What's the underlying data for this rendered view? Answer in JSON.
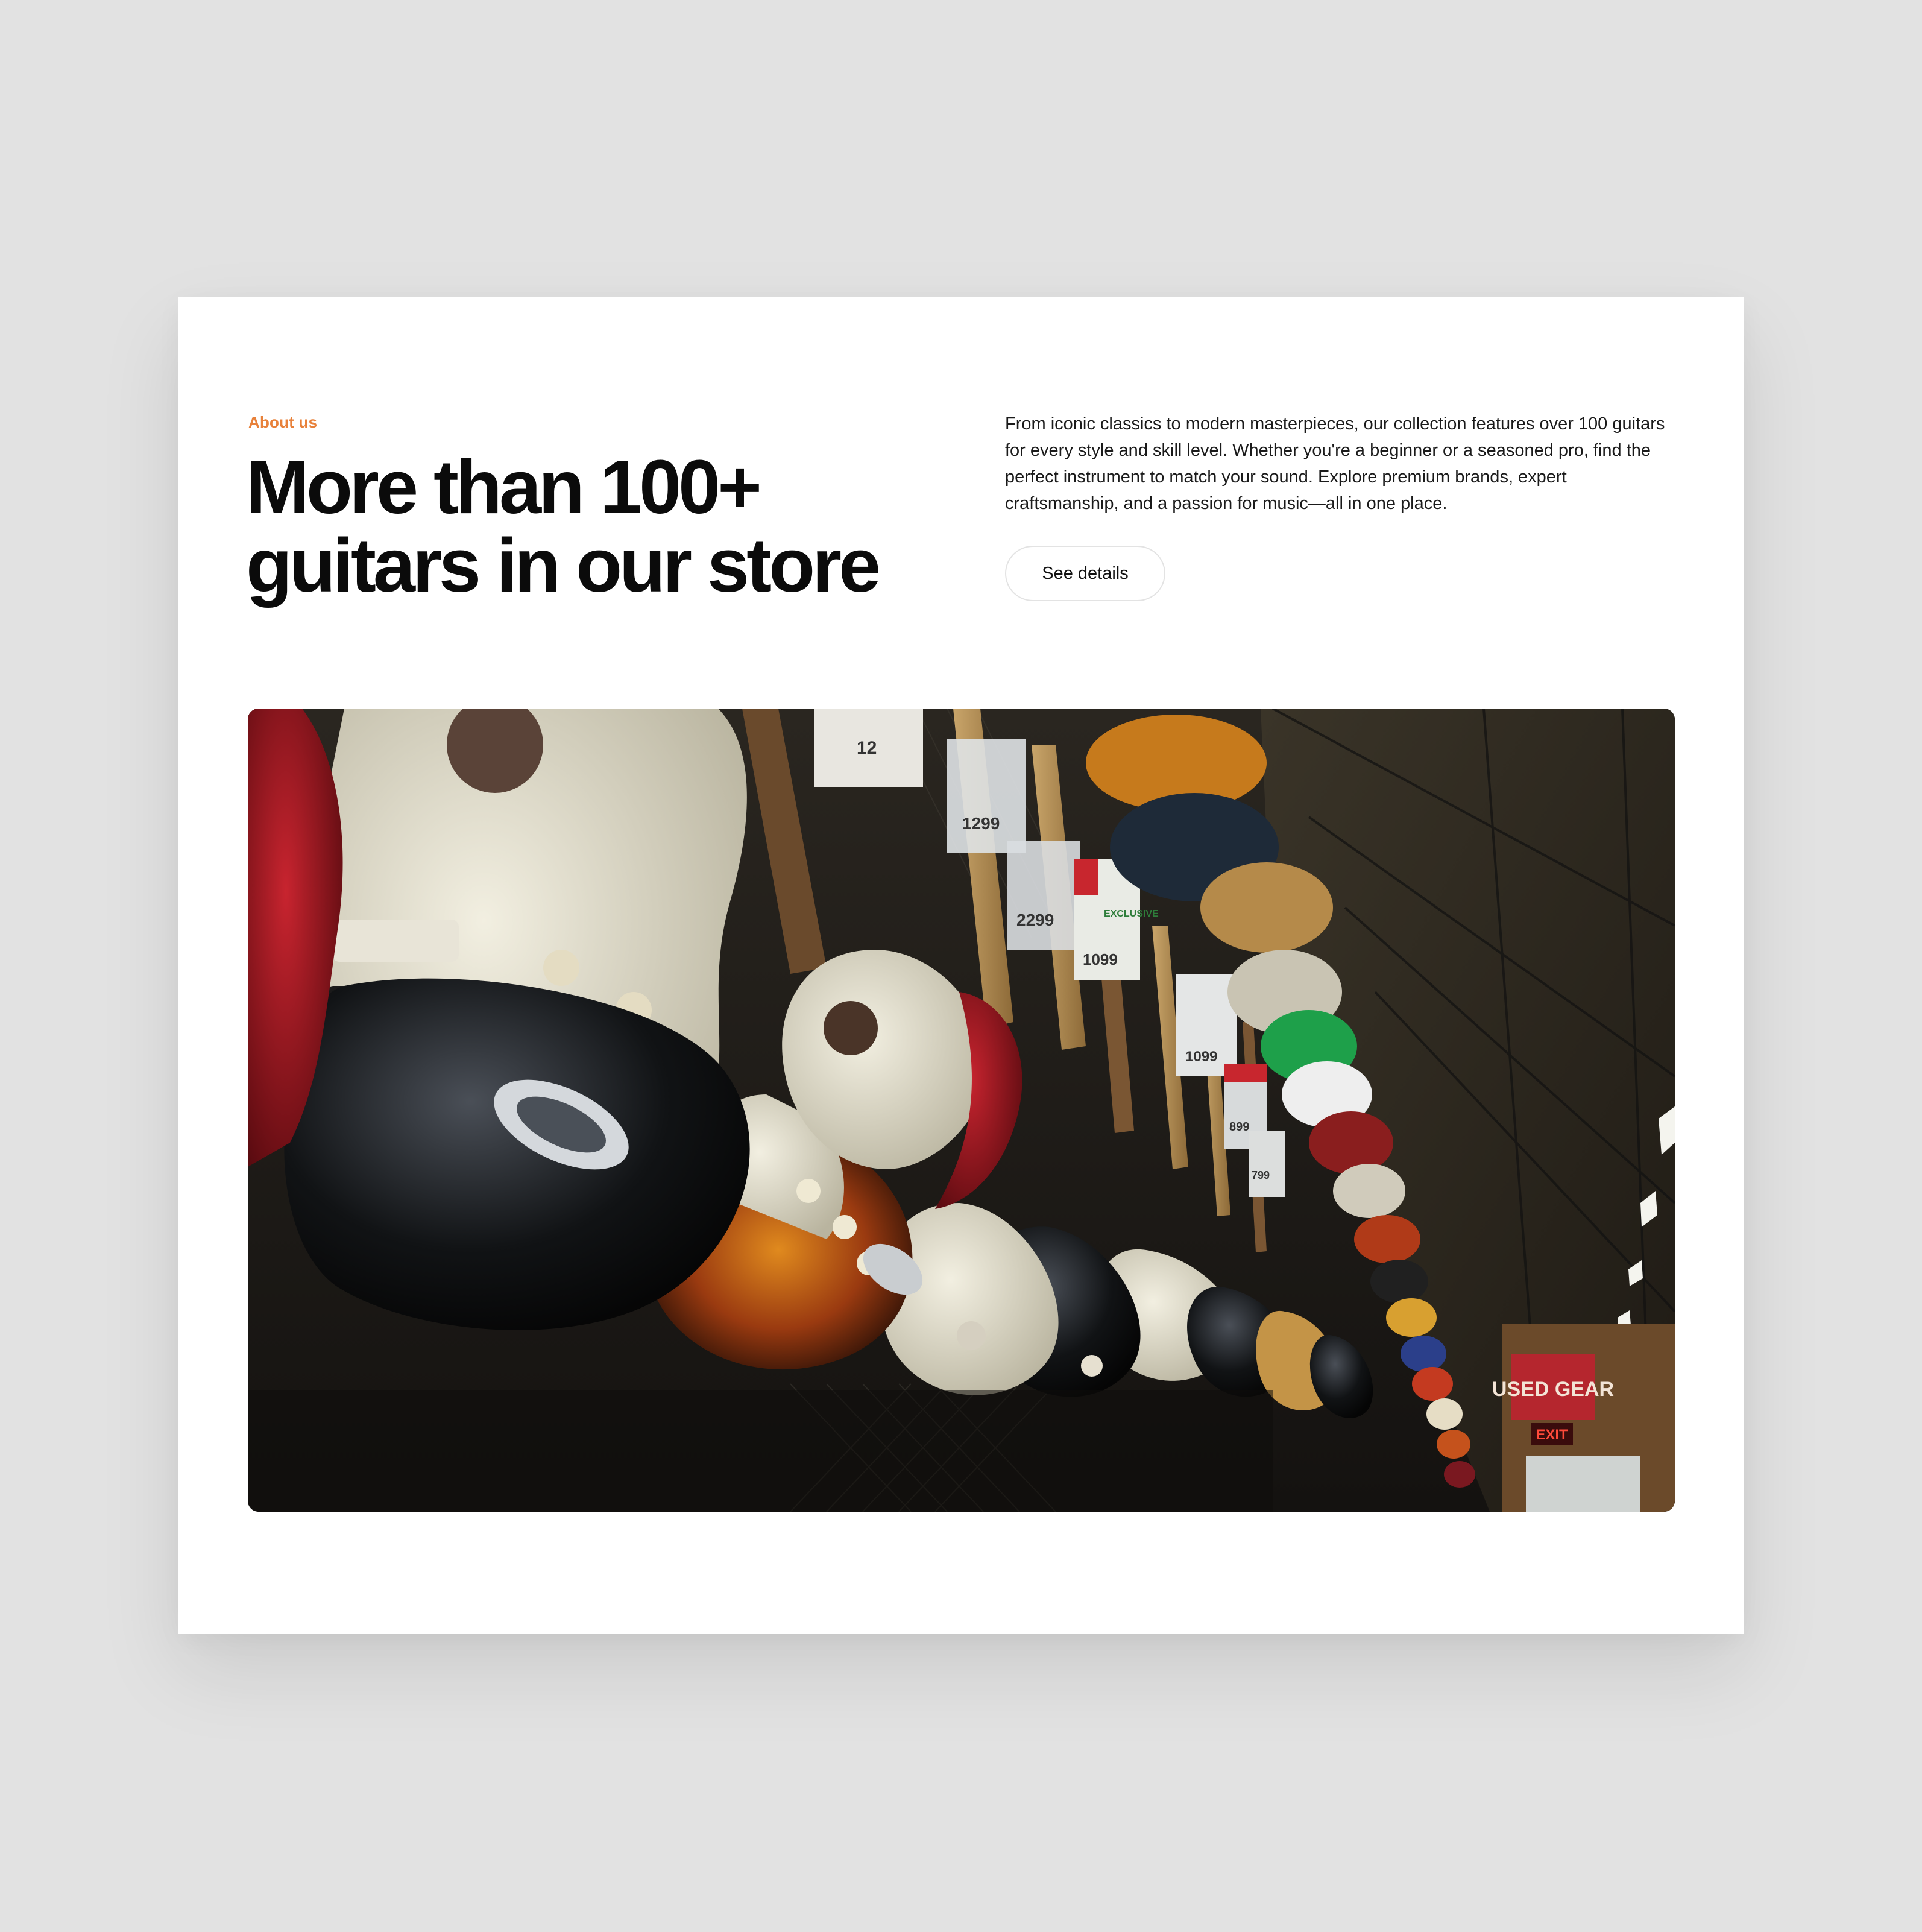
{
  "about": {
    "eyebrow": "About us",
    "title_line1": "More than 100+",
    "title_line2": "guitars in our store",
    "description": "From iconic classics to modern masterpieces, our collection features over 100 guitars for every style and skill level. Whether you're a beginner or a seasoned pro, find the perfect instrument to match your sound. Explore premium brands, expert craftsmanship, and a passion for music—all in one place.",
    "cta_label": "See details"
  },
  "photo": {
    "price_tags": [
      "12",
      "1299",
      "2299",
      "1099",
      "1099",
      "899",
      "799"
    ],
    "exclusive_label": "EXCLUSIVE",
    "used_gear_sign": "USED GEAR",
    "exit_sign": "EXIT"
  },
  "colors": {
    "accent": "#e8813a",
    "page_background": "#e2e2e2",
    "card_background": "#ffffff",
    "heading": "#0b0b0b"
  }
}
